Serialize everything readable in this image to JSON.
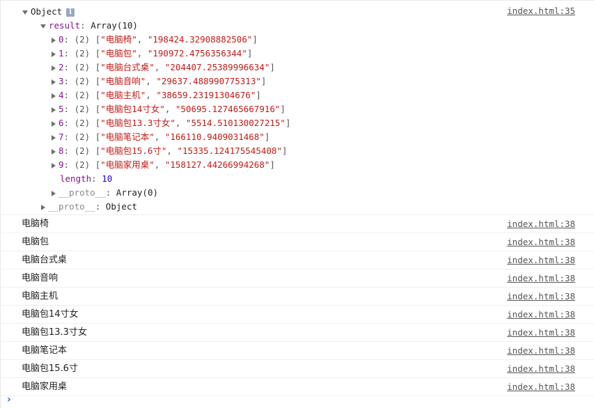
{
  "object_group": {
    "label": "Object",
    "info_glyph": "i",
    "source": "index.html:35",
    "result_key": "result",
    "result_type": "Array(10)",
    "items": [
      {
        "index": "0",
        "len": "(2)",
        "name": "\"电脑椅\"",
        "value": "\"198424.32908882506\""
      },
      {
        "index": "1",
        "len": "(2)",
        "name": "\"电脑包\"",
        "value": "\"190972.4756356344\""
      },
      {
        "index": "2",
        "len": "(2)",
        "name": "\"电脑台式桌\"",
        "value": "\"204407.25389996634\""
      },
      {
        "index": "3",
        "len": "(2)",
        "name": "\"电脑音响\"",
        "value": "\"29637.488990775313\""
      },
      {
        "index": "4",
        "len": "(2)",
        "name": "\"电脑主机\"",
        "value": "\"38659.23191304676\""
      },
      {
        "index": "5",
        "len": "(2)",
        "name": "\"电脑包14寸女\"",
        "value": "\"50695.127465667916\""
      },
      {
        "index": "6",
        "len": "(2)",
        "name": "\"电脑包13.3寸女\"",
        "value": "\"5514.510130027215\""
      },
      {
        "index": "7",
        "len": "(2)",
        "name": "\"电脑笔记本\"",
        "value": "\"166110.9409031468\""
      },
      {
        "index": "8",
        "len": "(2)",
        "name": "\"电脑包15.6寸\"",
        "value": "\"15335.124175545408\""
      },
      {
        "index": "9",
        "len": "(2)",
        "name": "\"电脑家用桌\"",
        "value": "\"158127.44266994268\""
      }
    ],
    "length_key": "length",
    "length_value": "10",
    "array_proto_key": "__proto__",
    "array_proto_value": "Array(0)",
    "object_proto_key": "__proto__",
    "object_proto_value": "Object"
  },
  "logs": [
    {
      "text": "电脑椅",
      "source": "index.html:38"
    },
    {
      "text": "电脑包",
      "source": "index.html:38"
    },
    {
      "text": "电脑台式桌",
      "source": "index.html:38"
    },
    {
      "text": "电脑音响",
      "source": "index.html:38"
    },
    {
      "text": "电脑主机",
      "source": "index.html:38"
    },
    {
      "text": "电脑包14寸女",
      "source": "index.html:38"
    },
    {
      "text": "电脑包13.3寸女",
      "source": "index.html:38"
    },
    {
      "text": "电脑笔记本",
      "source": "index.html:38"
    },
    {
      "text": "电脑包15.6寸",
      "source": "index.html:38"
    },
    {
      "text": "电脑家用桌",
      "source": "index.html:38"
    }
  ],
  "prompt": {
    "glyph": "›"
  },
  "colors": {
    "key": "#881391",
    "string": "#c41a16",
    "number": "#1c00cf",
    "prompt": "#2a6bd6"
  }
}
